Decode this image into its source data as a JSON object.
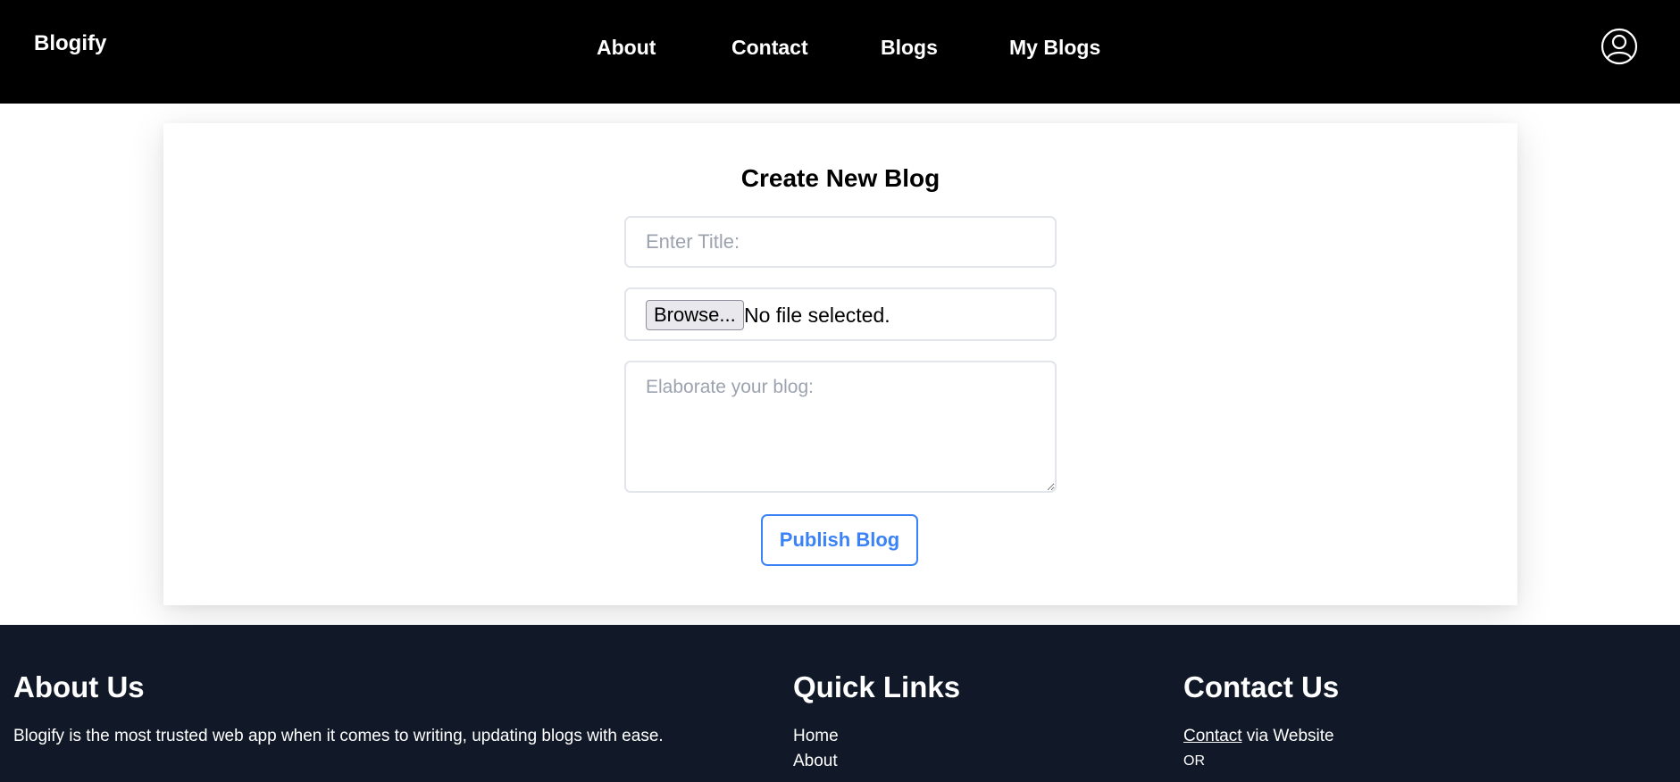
{
  "header": {
    "brand": "Blogify",
    "nav": [
      "About",
      "Contact",
      "Blogs",
      "My Blogs"
    ],
    "profile_icon": "user-circle-icon"
  },
  "form": {
    "title": "Create New Blog",
    "title_placeholder": "Enter Title:",
    "browse_label": "Browse...",
    "file_status": "No file selected.",
    "body_placeholder": "Elaborate your blog:",
    "publish_label": "Publish Blog"
  },
  "footer": {
    "about": {
      "heading": "About Us",
      "text": "Blogify is the most trusted web app when it comes to writing, updating blogs with ease."
    },
    "quick_links": {
      "heading": "Quick Links",
      "links": [
        "Home",
        "About"
      ]
    },
    "contact": {
      "heading": "Contact Us",
      "link_label": "Contact",
      "suffix": " via Website",
      "or_label": "OR"
    }
  },
  "colors": {
    "header_bg": "#000000",
    "footer_bg": "#111827",
    "accent": "#3b82f6"
  }
}
